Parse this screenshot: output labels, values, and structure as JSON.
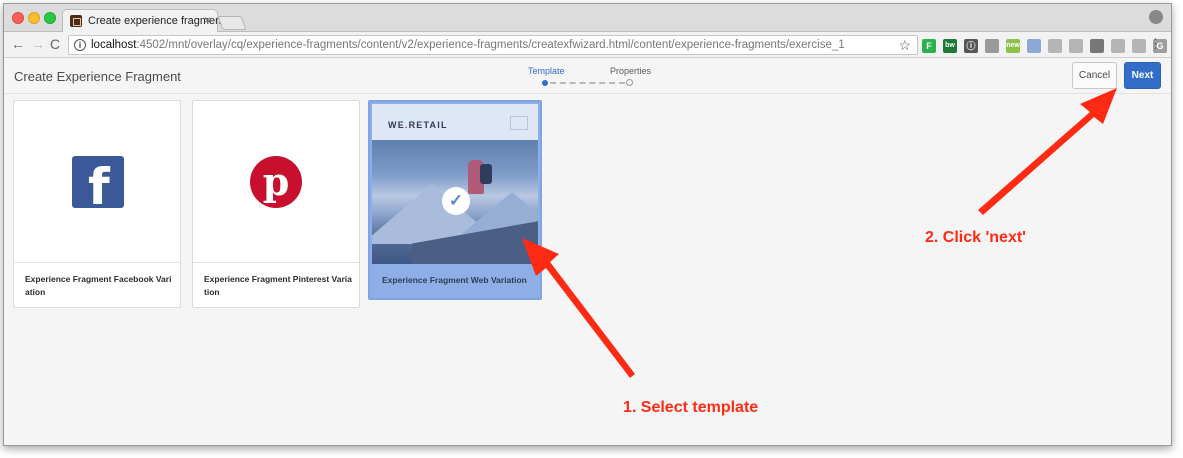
{
  "browser": {
    "tab_title": "Create experience fragment",
    "tab_close": "×",
    "url_host": "localhost",
    "url_rest": ":4502/mnt/overlay/cq/experience-fragments/content/v2/experience-fragments/createxfwizard.html/content/experience-fragments/exercise_1",
    "icons": {
      "back": "←",
      "forward": "→",
      "reload": "C",
      "info": "i",
      "bookmark": "☆",
      "menu": "⋮"
    },
    "extensions": [
      {
        "name": "feedly-icon",
        "glyph": "F",
        "color": "#2bb24c"
      },
      {
        "name": "bw-icon",
        "glyph": "bw",
        "color": "#1d7a36"
      },
      {
        "name": "info-circle-icon",
        "glyph": "ⓘ",
        "color": "#555555"
      },
      {
        "name": "leaf-icon",
        "glyph": "",
        "color": "#999999"
      },
      {
        "name": "android-new-icon",
        "glyph": "new",
        "color": "#8bc34a"
      },
      {
        "name": "paper-plane-icon",
        "glyph": "",
        "color": "#8aa9d6"
      },
      {
        "name": "puzzle-icon",
        "glyph": "",
        "color": "#b5b5b5"
      },
      {
        "name": "cloud-icon",
        "glyph": "",
        "color": "#b5b5b5"
      },
      {
        "name": "square-icon",
        "glyph": "",
        "color": "#777777"
      },
      {
        "name": "magnify-icon",
        "glyph": "",
        "color": "#b5b5b5"
      },
      {
        "name": "chat-icon",
        "glyph": "",
        "color": "#b5b5b5"
      },
      {
        "name": "g-icon",
        "glyph": "G",
        "color": "#9e9e9e"
      }
    ]
  },
  "app": {
    "page_title": "Create Experience Fragment",
    "steps": [
      "Template",
      "Properties"
    ],
    "cancel_label": "Cancel",
    "next_label": "Next"
  },
  "cards": [
    {
      "label": "Experience Fragment Facebook Variation",
      "logo_letter": "f",
      "logo_color": "#3b5998"
    },
    {
      "label": "Experience Fragment Pinterest Variation",
      "logo_letter": "p",
      "logo_color": "#c8102e"
    },
    {
      "label": "Experience Fragment Web Variation",
      "brand": "WE",
      "brand_dot": ".",
      "brand_rest": "RETAIL",
      "check": "✓",
      "selected": true
    }
  ],
  "annotations": {
    "next": "2. Click 'next'",
    "select": "1. Select template",
    "color": "#ff2a14"
  }
}
